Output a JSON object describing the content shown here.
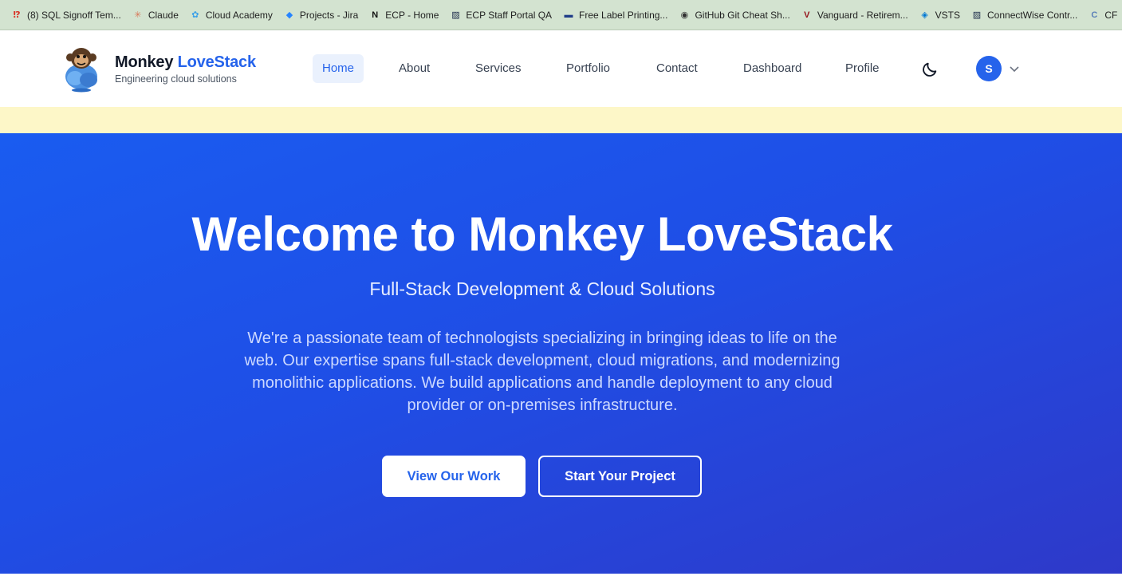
{
  "bookmarks": [
    {
      "label": "(8) SQL Signoff Tem...",
      "icon": "exclamation-question-icon",
      "color": "#d93025",
      "glyph": "⁉"
    },
    {
      "label": "Claude",
      "icon": "claude-spark-icon",
      "color": "#d97757",
      "glyph": "✳"
    },
    {
      "label": "Cloud Academy",
      "icon": "cloud-academy-icon",
      "color": "#3aa0e8",
      "glyph": "✿"
    },
    {
      "label": "Projects - Jira",
      "icon": "jira-icon",
      "color": "#2684ff",
      "glyph": "◆"
    },
    {
      "label": "ECP - Home",
      "icon": "notion-icon",
      "color": "#111111",
      "glyph": "N"
    },
    {
      "label": "ECP Staff Portal QA",
      "icon": "stripes-icon",
      "color": "#1b2a4a",
      "glyph": "▨"
    },
    {
      "label": "Free Label Printing...",
      "icon": "label-icon",
      "color": "#1f3c88",
      "glyph": "▬"
    },
    {
      "label": "GitHub Git Cheat Sh...",
      "icon": "globe-icon",
      "color": "#333333",
      "glyph": "◉"
    },
    {
      "label": "Vanguard - Retirem...",
      "icon": "vanguard-icon",
      "color": "#96151d",
      "glyph": "V"
    },
    {
      "label": "VSTS",
      "icon": "azure-devops-icon",
      "color": "#0078d4",
      "glyph": "◈"
    },
    {
      "label": "ConnectWise Contr...",
      "icon": "stripes-icon",
      "color": "#1b2a4a",
      "glyph": "▨"
    },
    {
      "label": "CF",
      "icon": "cf-icon",
      "color": "#5b7fb8",
      "glyph": "C"
    }
  ],
  "brand": {
    "name_prefix": "Monkey",
    "name_accent": "LoveStack",
    "tagline": "Engineering cloud solutions"
  },
  "nav": {
    "items": [
      "Home",
      "About",
      "Services",
      "Portfolio",
      "Contact",
      "Dashboard",
      "Profile"
    ],
    "active": "Home",
    "avatar_initial": "S"
  },
  "hero": {
    "title": "Welcome to Monkey LoveStack",
    "subtitle": "Full-Stack Development & Cloud Solutions",
    "description": "We're a passionate team of technologists specializing in bringing ideas to life on the web. Our expertise spans full-stack development, cloud migrations, and modernizing monolithic applications. We build applications and handle deployment to any cloud provider or on-premises infrastructure.",
    "primary_button": "View Our Work",
    "secondary_button": "Start Your Project"
  },
  "colors": {
    "accent": "#2563eb",
    "hero_start": "#1a5cf0",
    "hero_end": "#2e39c9",
    "notice_bg": "#fdf7c8",
    "bookmarks_bg": "#d3e3d0"
  }
}
